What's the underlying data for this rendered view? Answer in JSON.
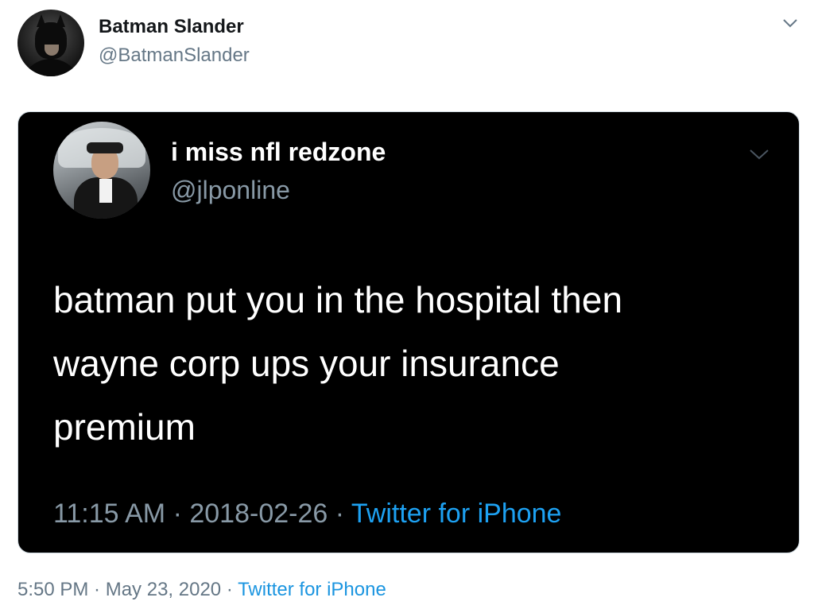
{
  "author": {
    "name": "Batman Slander",
    "handle": "@BatmanSlander"
  },
  "quoted_tweet": {
    "author_name": "i miss nfl redzone",
    "author_handle": "@jlponline",
    "text_lines": [
      "batman put you in the hospital then",
      "wayne corp ups your insurance",
      "premium"
    ],
    "time": "11:15 AM",
    "date": "2018-02-26",
    "source": "Twitter for iPhone"
  },
  "tweet_meta": {
    "time": "5:50 PM",
    "date": "May 23, 2020",
    "source": "Twitter for iPhone"
  },
  "separator": " · ",
  "icons": {
    "author_avatar": "avatar-image",
    "menu": "chevron-down-icon",
    "quoted_avatar": "avatar-image",
    "quoted_menu": "chevron-down-icon"
  },
  "colors": {
    "link": "#1b95e0",
    "secondary_text": "#657786",
    "card_background": "#000000"
  }
}
